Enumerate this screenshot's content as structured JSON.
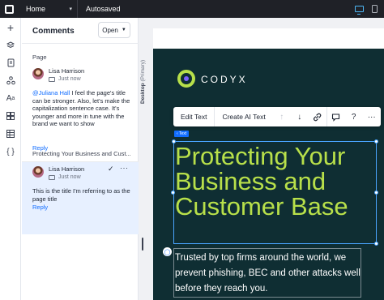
{
  "topbar": {
    "page_name": "Home",
    "status": "Autosaved",
    "icons": [
      "wix-logo-icon",
      "desktop-icon",
      "mobile-icon"
    ]
  },
  "rail": {
    "icons": [
      "add-icon",
      "layers-icon",
      "pages-icon",
      "apps-icon",
      "text-theme-icon",
      "widgets-icon",
      "table-icon",
      "code-icon"
    ]
  },
  "comments": {
    "title": "Comments",
    "filter_label": "Open",
    "threads": [
      {
        "section": "Page",
        "author": "Lisa Harrison",
        "time": "Just now",
        "mention": "@Juliana Hall",
        "text": " I feel the page's title can be stronger. Also, let's make the capitalization sentence case. It's younger and more in tune with the brand we want to show",
        "reply": "Reply"
      },
      {
        "section": "Protecting Your Business and Cust...",
        "author": "Lisa Harrison",
        "time": "Just now",
        "text": "This is the title I'm referring to as the page title",
        "reply": "Reply"
      }
    ]
  },
  "canvas": {
    "breakpoint_label": "Desktop",
    "breakpoint_sub": "(Primary)",
    "brand": "CODYX",
    "brand_colors": {
      "accent": "#b8e04a",
      "background": "#0f2e33",
      "logo_dot": "#7b61ff",
      "selection": "#116dff"
    },
    "toolbar": {
      "edit_text": "Edit Text",
      "create_ai_text": "Create AI Text",
      "icons": [
        "arrow-up-icon",
        "arrow-down-icon",
        "link-icon",
        "comment-icon",
        "help-icon",
        "more-icon"
      ]
    },
    "element_tag": "Text",
    "heading": "Protecting Your Business and Customer Base",
    "paragraph": "Trusted by top firms around the world, we prevent phishing, BEC and other attacks well before they reach you."
  }
}
